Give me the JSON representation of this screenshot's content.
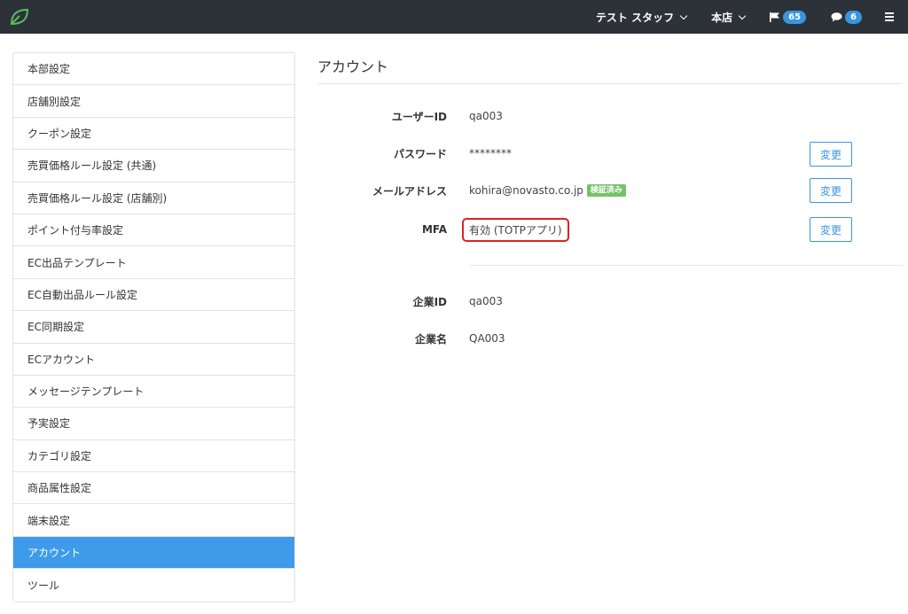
{
  "navbar": {
    "staff_label": "テスト スタッフ",
    "store_label": "本店",
    "flag_count": "65",
    "message_count": "6"
  },
  "sidebar": {
    "items": [
      {
        "label": "本部設定",
        "active": false
      },
      {
        "label": "店舗別設定",
        "active": false
      },
      {
        "label": "クーポン設定",
        "active": false
      },
      {
        "label": "売買価格ルール設定 (共通)",
        "active": false
      },
      {
        "label": "売買価格ルール設定 (店舗別)",
        "active": false
      },
      {
        "label": "ポイント付与率設定",
        "active": false
      },
      {
        "label": "EC出品テンプレート",
        "active": false
      },
      {
        "label": "EC自動出品ルール設定",
        "active": false
      },
      {
        "label": "EC同期設定",
        "active": false
      },
      {
        "label": "ECアカウント",
        "active": false
      },
      {
        "label": "メッセージテンプレート",
        "active": false
      },
      {
        "label": "予実設定",
        "active": false
      },
      {
        "label": "カテゴリ設定",
        "active": false
      },
      {
        "label": "商品属性設定",
        "active": false
      },
      {
        "label": "端末設定",
        "active": false
      },
      {
        "label": "アカウント",
        "active": true
      },
      {
        "label": "ツール",
        "active": false
      }
    ]
  },
  "main": {
    "title": "アカウント",
    "user_id": {
      "label": "ユーザーID",
      "value": "qa003"
    },
    "password": {
      "label": "パスワード",
      "value": "********",
      "button": "変更"
    },
    "email": {
      "label": "メールアドレス",
      "value": "kohira@novasto.co.jp",
      "badge": "検証済み",
      "button": "変更"
    },
    "mfa": {
      "label": "MFA",
      "value": "有効 (TOTPアプリ)",
      "button": "変更"
    },
    "company_id": {
      "label": "企業ID",
      "value": "qa003"
    },
    "company_name": {
      "label": "企業名",
      "value": "QA003"
    }
  },
  "colors": {
    "navbar_bg": "#2d3238",
    "accent": "#3a95e0",
    "active_item": "#3d9be9",
    "verified": "#76c26a",
    "highlight": "#e02020"
  }
}
